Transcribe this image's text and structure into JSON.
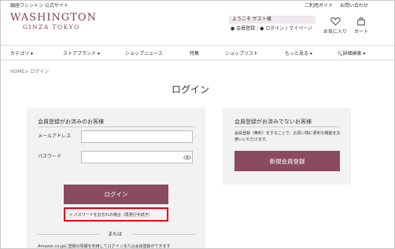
{
  "topbar": {
    "left": "銀座ワシントン 公式サイト",
    "links": [
      "ご利用ガイド",
      "お問い合わせ"
    ]
  },
  "logo": {
    "line1": "WASHINGTON",
    "line2": "GINZA TOKYO"
  },
  "welcome": {
    "greeting": "ようこそ ゲスト様",
    "register": "会員登録",
    "login": "ログイン",
    "mypage": "マイページ",
    "separator": "|"
  },
  "header_icons": {
    "favorites": "お気に入り",
    "cart": "カート"
  },
  "nav": {
    "items": [
      "カテゴリ ▾",
      "ストアブランド ▾",
      "ショップニュース",
      "特集",
      "ショップリスト",
      "もっと見る ▾",
      "詳細検索 ▾"
    ]
  },
  "breadcrumb": "HOME> ログイン",
  "page_title": "ログイン",
  "member_card": {
    "title": "会員登録がお済みのお客様",
    "email_label": "メールアドレス",
    "email_value": "",
    "password_label": "パスワード",
    "password_value": "",
    "login_button": "ログイン",
    "forgot_link": "> パスワードをお忘れの場合（再発行手続き）",
    "or": "または",
    "amazon_text": "Amazon.co.jpに登録の情報を利用してログインまたは会員登録ができます"
  },
  "guest_card": {
    "title": "会員登録がお済みでないお客様",
    "description": "会員登録（無料）をすることで、お買い物に便利な機能をお使いいただけます。",
    "register_button": "新規会員登録"
  },
  "colors": {
    "accent": "#8a4a60",
    "highlight": "#e3001b"
  }
}
